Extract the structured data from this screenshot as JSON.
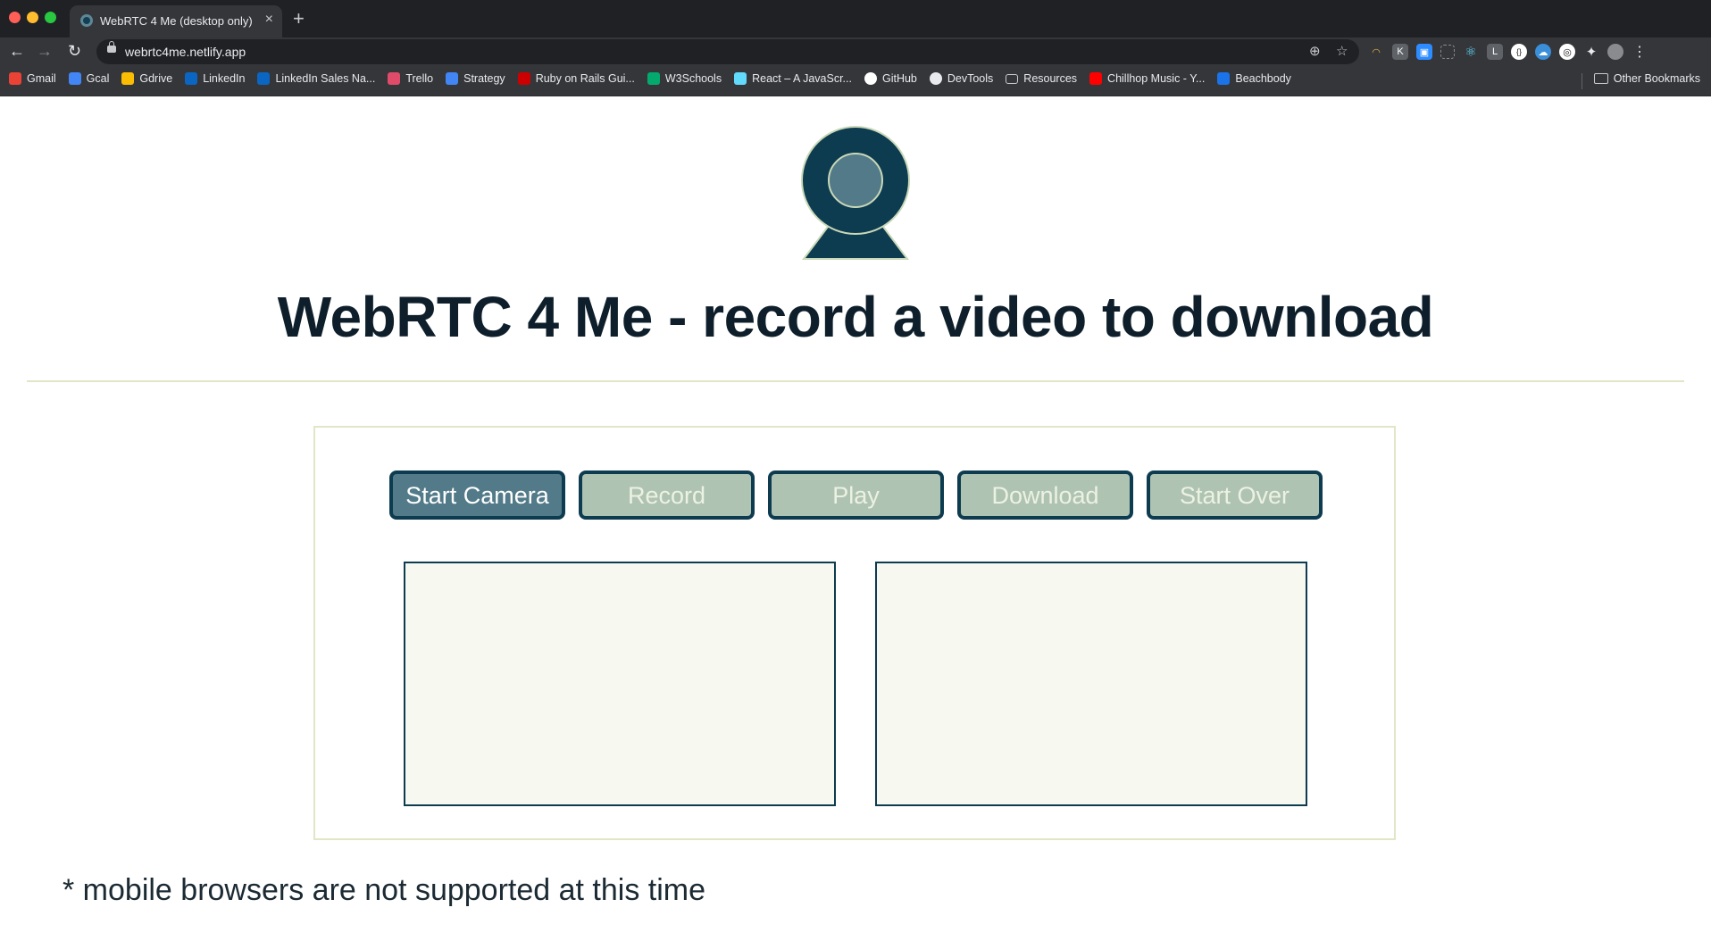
{
  "browser": {
    "tab_title": "WebRTC 4 Me (desktop only)",
    "tab_close": "×",
    "new_tab": "+",
    "url": "webrtc4me.netlify.app",
    "nav": {
      "back": "←",
      "forward": "→",
      "reload": "↻"
    },
    "omni_icons": {
      "zoom": "⊕",
      "star": "☆"
    },
    "menu": "⋮",
    "bookmarks": [
      {
        "label": "Gmail",
        "icon": "gmail-icon",
        "color": "#ea4335"
      },
      {
        "label": "Gcal",
        "icon": "calendar-icon",
        "color": "#4285f4"
      },
      {
        "label": "Gdrive",
        "icon": "drive-icon",
        "color": "#fbbc04"
      },
      {
        "label": "LinkedIn",
        "icon": "linkedin-icon",
        "color": "#0a66c2"
      },
      {
        "label": "LinkedIn Sales Na...",
        "icon": "compass-icon",
        "color": "#0a66c2"
      },
      {
        "label": "Trello",
        "icon": "trello-icon",
        "color": "#e14b6a"
      },
      {
        "label": "Strategy",
        "icon": "docs-icon",
        "color": "#4285f4"
      },
      {
        "label": "Ruby on Rails Gui...",
        "icon": "rails-icon",
        "color": "#cc0000"
      },
      {
        "label": "W3Schools",
        "icon": "w3schools-icon",
        "color": "#04aa6d"
      },
      {
        "label": "React – A JavaScr...",
        "icon": "react-icon",
        "color": "#61dafb"
      },
      {
        "label": "GitHub",
        "icon": "github-icon",
        "color": "#ffffff"
      },
      {
        "label": "DevTools",
        "icon": "devtools-icon",
        "color": "#e8eaed"
      },
      {
        "label": "Resources",
        "icon": "folder-icon",
        "color": "#c9cacd"
      },
      {
        "label": "Chillhop Music - Y...",
        "icon": "youtube-icon",
        "color": "#ff0000"
      },
      {
        "label": "Beachbody",
        "icon": "beachbody-icon",
        "color": "#1a73e8"
      }
    ],
    "other_bookmarks": "Other Bookmarks"
  },
  "page": {
    "title": "WebRTC 4 Me - record a video to download",
    "buttons": {
      "start_camera": "Start Camera",
      "record": "Record",
      "play": "Play",
      "download": "Download",
      "start_over": "Start Over"
    },
    "footnote": "* mobile browsers are not supported at this time"
  },
  "colors": {
    "primary_dark": "#0d3b50",
    "button_active": "#527a88",
    "button_disabled": "#afc3b3",
    "panel_border": "#e1e6c7",
    "video_bg": "#f7f9f0"
  }
}
